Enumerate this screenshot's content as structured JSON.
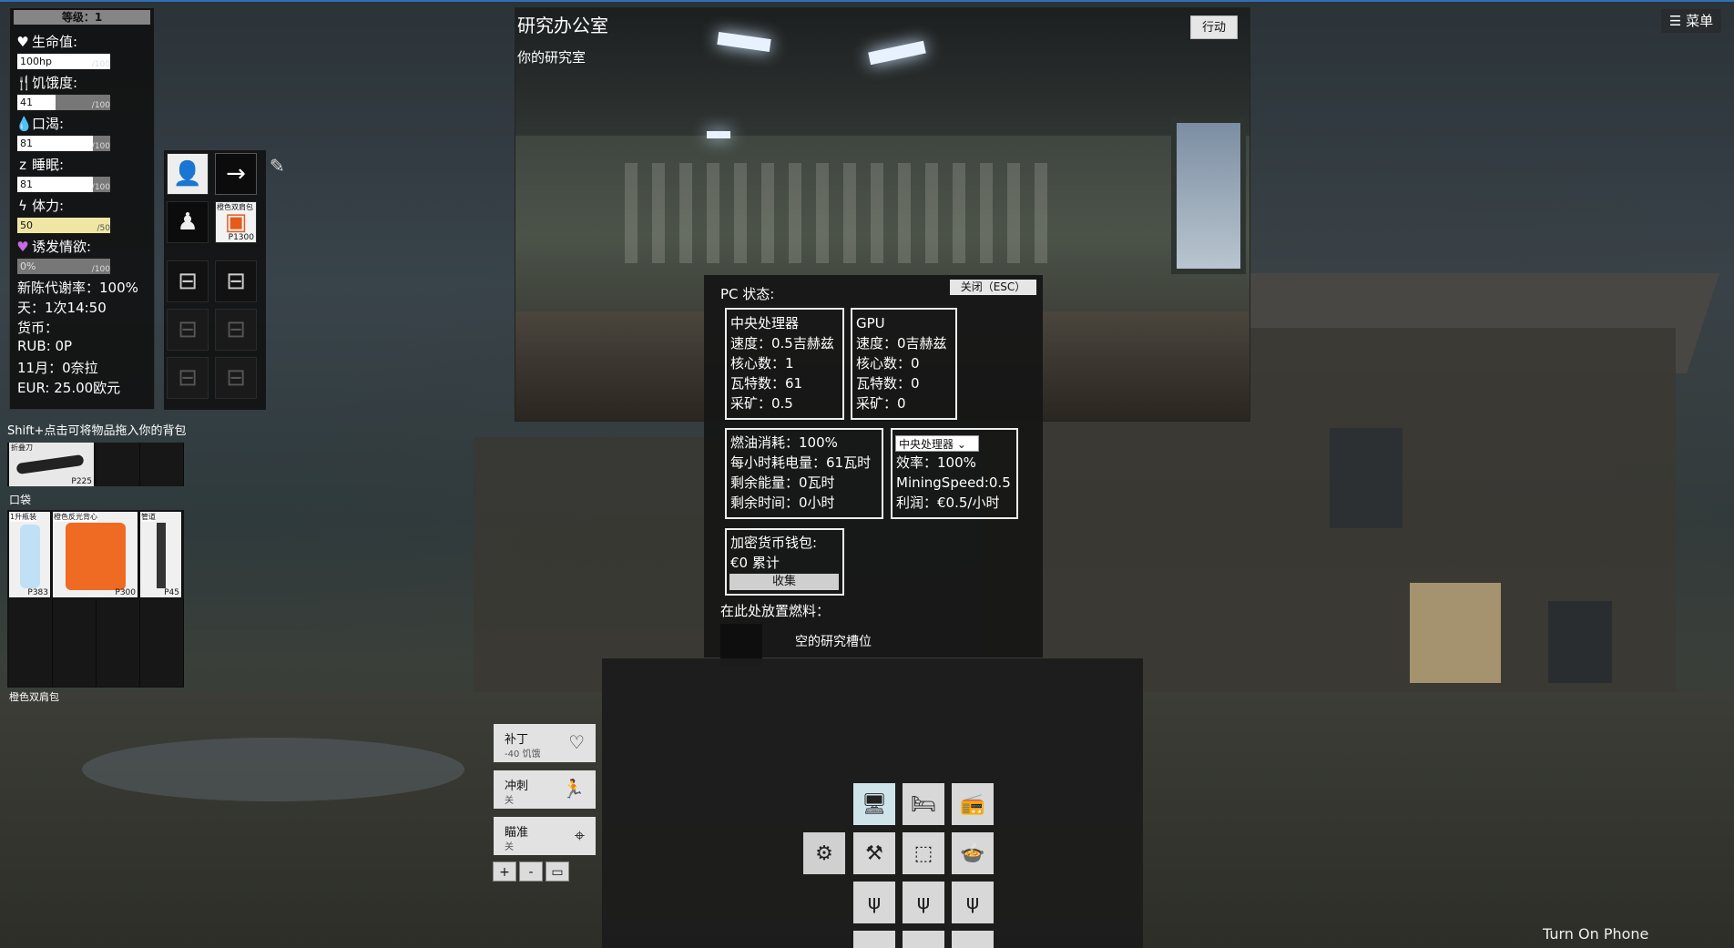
{
  "stats": {
    "level": "等级：1",
    "health_label": "生命值:",
    "health_value": "100hp",
    "health_max": "/100",
    "health_fraction": 1.0,
    "hunger_label": "饥饿度:",
    "hunger_value": "41",
    "hunger_max": "/100",
    "hunger_fraction": 0.41,
    "thirst_label": "口渴:",
    "thirst_value": "81",
    "thirst_max": "/100",
    "thirst_fraction": 0.81,
    "sleep_label": "睡眠:",
    "sleep_value": "81",
    "sleep_max": "/100",
    "sleep_fraction": 0.81,
    "stamina_label": "体力:",
    "stamina_value": "50",
    "stamina_max": "/50",
    "stamina_fraction": 1.0,
    "arousal_label": "诱发情欲:",
    "arousal_value": "0%",
    "arousal_max": "/100",
    "arousal_fraction": 0.0,
    "metabolism": "新陈代谢率：100%",
    "day": "天：1次14:50",
    "currency_label": "货币：",
    "rub": "RUB: 0P",
    "month": "11月：0奈拉",
    "eur": "EUR: 25.00欧元"
  },
  "equipment": {
    "backpack_tag": "橙色双肩包",
    "backpack_price": "P1300"
  },
  "inventory": {
    "hint": "Shift+点击可将物品拖入你的背包",
    "knife_tag": "折叠刀",
    "knife_price": "P225",
    "pocket_label": "口袋",
    "bottle_tag": "1升瓶装",
    "bottle_price": "P383",
    "vest_tag": "橙色反光背心",
    "vest_price": "P300",
    "pipe_tag": "管道",
    "pipe_price": "P45",
    "backpack_label": "橙色双肩包"
  },
  "room": {
    "title": "研究办公室",
    "subtitle": "你的研究室",
    "action_button": "行动"
  },
  "menu": {
    "label": "☰ 菜单"
  },
  "pc": {
    "title": "PC 状态:",
    "close": "关闭（ESC）",
    "cpu": {
      "name": "中央处理器",
      "speed": "速度：0.5吉赫兹",
      "cores": "核心数：1",
      "watts": "瓦特数：61",
      "mining": "采矿：0.5"
    },
    "gpu": {
      "name": "GPU",
      "speed": "速度：0吉赫兹",
      "cores": "核心数：0",
      "watts": "瓦特数：0",
      "mining": "采矿：0"
    },
    "power": {
      "fuel": "燃油消耗：100%",
      "hourly": "每小时耗电量：61瓦时",
      "remaining_energy": "剩余能量：0瓦时",
      "remaining_time": "剩余时间：0小时"
    },
    "mining": {
      "select": "中央处理器 ⌄",
      "efficiency": "效率：100%",
      "speed": "MiningSpeed:0.5",
      "profit": "利润：€0.5/小时"
    },
    "wallet": {
      "label": "加密货币钱包:",
      "total": "€0 累计",
      "collect": "收集"
    },
    "fuel_label": "在此处放置燃料：",
    "empty_slot": "空的研究槽位"
  },
  "actions": {
    "patch_title": "补丁",
    "patch_sub": "-40 饥饿",
    "sprint_title": "冲刺",
    "sprint_sub": "关",
    "aim_title": "瞄准",
    "aim_sub": "关",
    "plus": "+",
    "minus": "-",
    "square": "▭"
  },
  "footer": {
    "phone": "Turn On Phone"
  },
  "icons": [
    "heart-icon",
    "utensils-icon",
    "drop-icon",
    "sleep-icon",
    "bolt-icon",
    "arousal-heart-icon",
    "head-icon",
    "arrow-right-icon",
    "torso-icon",
    "backpack-icon",
    "pocket-icon",
    "knife-icon",
    "bottle-icon",
    "vest-icon",
    "pipe-icon",
    "patch-heart-icon",
    "sprint-icon",
    "crosshair-icon",
    "gear-icon",
    "computer-icon",
    "bed-icon",
    "radio-icon",
    "workbench-icon",
    "empty-slot-icon",
    "pot-icon",
    "grass-icon",
    "syringe-icon"
  ]
}
